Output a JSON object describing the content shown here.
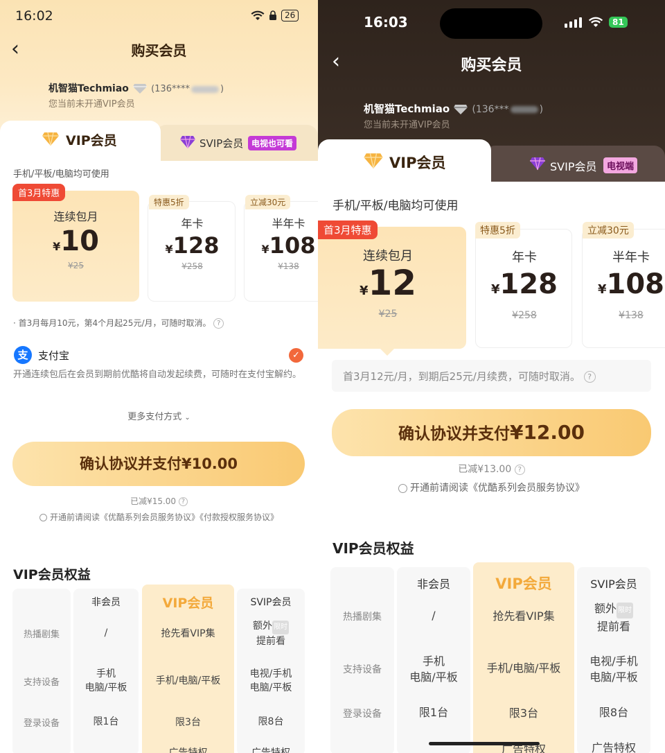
{
  "left": {
    "status": {
      "time": "16:02",
      "battery": "26"
    },
    "header": {
      "title": "购买会员"
    },
    "user": {
      "name": "机智猫Techmiao",
      "phone_prefix": "(136****",
      "phone_suffix": ")",
      "status": "您当前未开通VIP会员"
    },
    "tabs": {
      "vip": "VIP会员",
      "svip": "SVIP会员",
      "svip_badge": "电视也可看"
    },
    "devices_hint": "手机/平板/电脑均可使用",
    "plans": [
      {
        "promo": "首3月特惠",
        "name": "连续包月",
        "yen": "¥",
        "price": "10",
        "original": "¥25"
      },
      {
        "promo": "特惠5折",
        "name": "年卡",
        "yen": "¥",
        "price": "128",
        "original": "¥258"
      },
      {
        "promo": "立减30元",
        "name": "半年卡",
        "yen": "¥",
        "price": "108",
        "original": "¥138"
      }
    ],
    "plan_note": "· 首3月每月10元，第4个月起25元/月，可随时取消。",
    "payment": {
      "name": "支付宝",
      "icon_char": "支",
      "desc": "开通连续包后在会员到期前优酷将自动发起续费，可随时在支付宝解约。",
      "more": "更多支付方式"
    },
    "pay_button": "确认协议并支付¥10.00",
    "saved": "已减¥15.00",
    "agreement": "开通前请阅读《优酷系列会员服务协议》《付款授权服务协议》",
    "benefits": {
      "title": "VIP会员权益",
      "columns": [
        "非会员",
        "VIP会员",
        "SVIP会员"
      ],
      "rows": [
        {
          "label": "热播剧集",
          "non": "/",
          "vip": "抢先看VIP集",
          "svip_1": "额外",
          "svip_badge": "限时",
          "svip_2": "提前看"
        },
        {
          "label": "支持设备",
          "non_1": "手机",
          "non_2": "电脑/平板",
          "vip": "手机/电脑/平板",
          "svip_1": "电视/手机",
          "svip_2": "电脑/平板"
        },
        {
          "label": "登录设备",
          "non": "限1台",
          "vip": "限3台",
          "svip": "限8台"
        }
      ],
      "partial_vip": "广告特权",
      "partial_svip": "广告特权"
    }
  },
  "right": {
    "status": {
      "time": "16:03",
      "battery": "81"
    },
    "header": {
      "title": "购买会员"
    },
    "user": {
      "name": "机智猫Techmiao",
      "phone_prefix": "(136***",
      "phone_suffix": ")",
      "status": "您当前未开通VIP会员"
    },
    "tabs": {
      "vip": "VIP会员",
      "svip": "SVIP会员",
      "svip_badge": "电视端"
    },
    "devices_hint": "手机/平板/电脑均可使用",
    "plans": [
      {
        "promo": "首3月特惠",
        "name": "连续包月",
        "yen": "¥",
        "price": "12",
        "original": "¥25"
      },
      {
        "promo": "特惠5折",
        "name": "年卡",
        "yen": "¥",
        "price": "128",
        "original": "¥258"
      },
      {
        "promo": "立减30元",
        "name": "半年卡",
        "yen": "¥",
        "price": "108",
        "original": "¥138"
      }
    ],
    "plan_note": "首3月12元/月，到期后25元/月续费，可随时取消。",
    "pay_button_label": "确认协议并支付",
    "pay_button_amount": "¥12.00",
    "saved": "已减¥13.00",
    "agreement": "开通前请阅读《优酷系列会员服务协议》",
    "benefits": {
      "title": "VIP会员权益",
      "columns": [
        "非会员",
        "VIP会员",
        "SVIP会员"
      ],
      "rows": [
        {
          "label": "热播剧集",
          "non": "/",
          "vip": "抢先看VIP集",
          "svip_1": "额外",
          "svip_badge": "限时",
          "svip_2": "提前看"
        },
        {
          "label": "支持设备",
          "non_1": "手机",
          "non_2": "电脑/平板",
          "vip": "手机/电脑/平板",
          "svip_1": "电视/手机",
          "svip_2": "电脑/平板"
        },
        {
          "label": "登录设备",
          "non": "限1台",
          "vip": "限3台",
          "svip": "限8台"
        }
      ],
      "partial_vip": "广告特权",
      "partial_svip": "广告特权"
    }
  },
  "colors": {
    "accent_orange": "#f2683b",
    "promo_red": "#ef4a35",
    "pay_gold": "#f9c972",
    "vip_gold": "#f3a93b",
    "svip_purple": "#c43ad6"
  },
  "icons": [
    "back-chevron-icon",
    "wifi-icon",
    "battery-icon",
    "cellular-signal-icon",
    "diamond-icon",
    "svip-gem-icon",
    "alipay-icon",
    "check-icon",
    "chevron-down-icon",
    "question-icon",
    "radio-icon"
  ]
}
